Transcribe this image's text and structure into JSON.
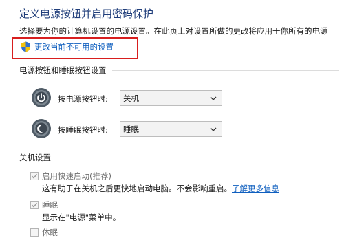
{
  "page": {
    "title": "定义电源按钮并启用密码保护",
    "description": "选择要为你的计算机设置的电源设置。在此页上对设置所做的更改将应用于你所有的电源",
    "change_settings_link": "更改当前不可用的设置"
  },
  "power_buttons_section": {
    "heading": "电源按钮和睡眠按钮设置",
    "rows": [
      {
        "label": "按电源按钮时:",
        "value": "关机",
        "icon": "power-icon"
      },
      {
        "label": "按睡眠按钮时:",
        "value": "睡眠",
        "icon": "sleep-icon"
      }
    ]
  },
  "shutdown_section": {
    "heading": "关机设置",
    "options": [
      {
        "label": "启用快速启动(推荐)",
        "checked": true,
        "description": "这有助于在关机之后更快地启动电脑。不会影响重启。",
        "link": "了解更多信息"
      },
      {
        "label": "睡眠",
        "checked": true,
        "description": "显示在\"电源\"菜单中。"
      },
      {
        "label": "休眠",
        "checked": false
      }
    ]
  },
  "colors": {
    "link": "#0f5fbf",
    "title": "#1f3d7a",
    "highlight": "#d81e1e"
  }
}
